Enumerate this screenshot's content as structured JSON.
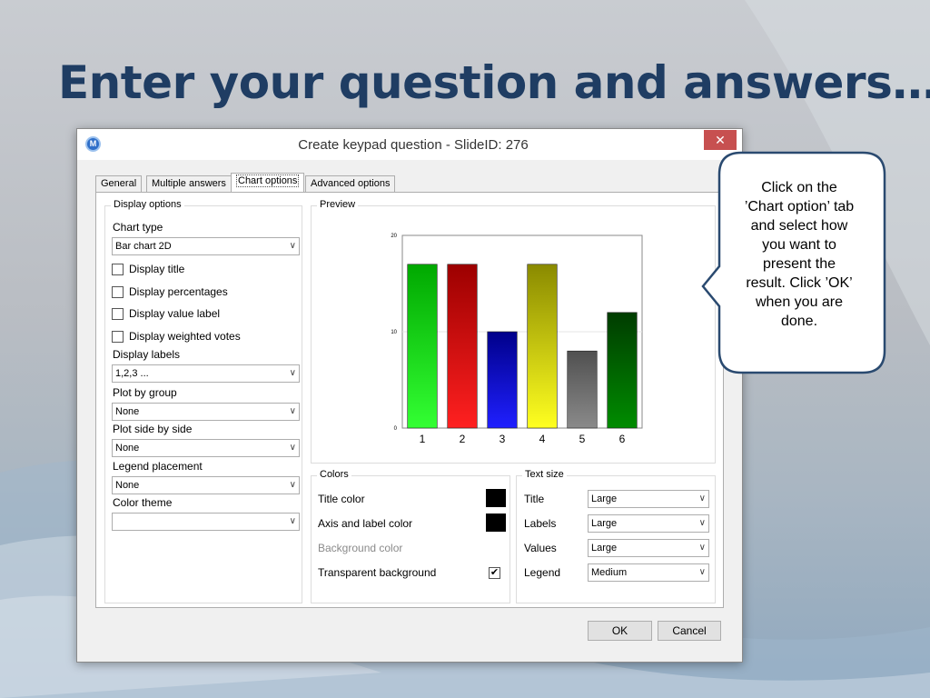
{
  "slide": {
    "title": "Enter your question and answers…"
  },
  "callout": {
    "line1": "Click on the",
    "line2": "’Chart option’ tab",
    "line3": "and select how",
    "line4": "you want to",
    "line5": "present the",
    "line6": "result. Click ’OK’",
    "line7": "when you are",
    "line8": "done."
  },
  "window": {
    "title": "Create keypad question - SlideID: 276",
    "close_glyph": "✕",
    "icon_glyph": "M"
  },
  "tabs": [
    {
      "label": "General"
    },
    {
      "label": "Multiple answers"
    },
    {
      "label": "Chart options"
    },
    {
      "label": "Advanced options"
    }
  ],
  "display_options": {
    "title": "Display options",
    "chart_type_label": "Chart type",
    "chart_type_value": "Bar chart 2D",
    "display_title": "Display title",
    "display_percentages": "Display percentages",
    "display_value_label": "Display value label",
    "display_weighted_votes": "Display weighted votes",
    "display_labels_label": "Display labels",
    "display_labels_value": "1,2,3 ...",
    "plot_by_group_label": "Plot by group",
    "plot_by_group_value": "None",
    "plot_side_by_side_label": "Plot side by side",
    "plot_side_by_side_value": "None",
    "legend_placement_label": "Legend placement",
    "legend_placement_value": "None",
    "color_theme_label": "Color theme",
    "color_theme_value": "",
    "dropdown_glyph": "∨"
  },
  "preview": {
    "title": "Preview"
  },
  "chart_data": {
    "type": "bar",
    "categories": [
      "1",
      "2",
      "3",
      "4",
      "5",
      "6"
    ],
    "values": [
      17,
      17,
      10,
      17,
      8,
      12
    ],
    "ylim": [
      0,
      20
    ],
    "yticks": [
      "0",
      "10",
      "20"
    ],
    "title": "",
    "xlabel": "",
    "ylabel": "",
    "grid": true,
    "colors": [
      [
        "#00a800",
        "#33ff33"
      ],
      [
        "#9c0000",
        "#ff2020"
      ],
      [
        "#00008a",
        "#2020ff"
      ],
      [
        "#8a8a00",
        "#ffff20"
      ],
      [
        "#505050",
        "#8a8a8a"
      ],
      [
        "#003c00",
        "#008c00"
      ]
    ]
  },
  "colors": {
    "title": "Colors",
    "title_color": "Title color",
    "axis_label_color": "Axis and label color",
    "background_color": "Background color",
    "transparent_background": "Transparent background",
    "check_glyph": "✔",
    "swatch_color": "#000000"
  },
  "text_size": {
    "title": "Text size",
    "rows": [
      {
        "label": "Title",
        "value": "Large"
      },
      {
        "label": "Labels",
        "value": "Large"
      },
      {
        "label": "Values",
        "value": "Large"
      },
      {
        "label": "Legend",
        "value": "Medium"
      }
    ]
  },
  "buttons": {
    "ok": "OK",
    "cancel": "Cancel"
  }
}
